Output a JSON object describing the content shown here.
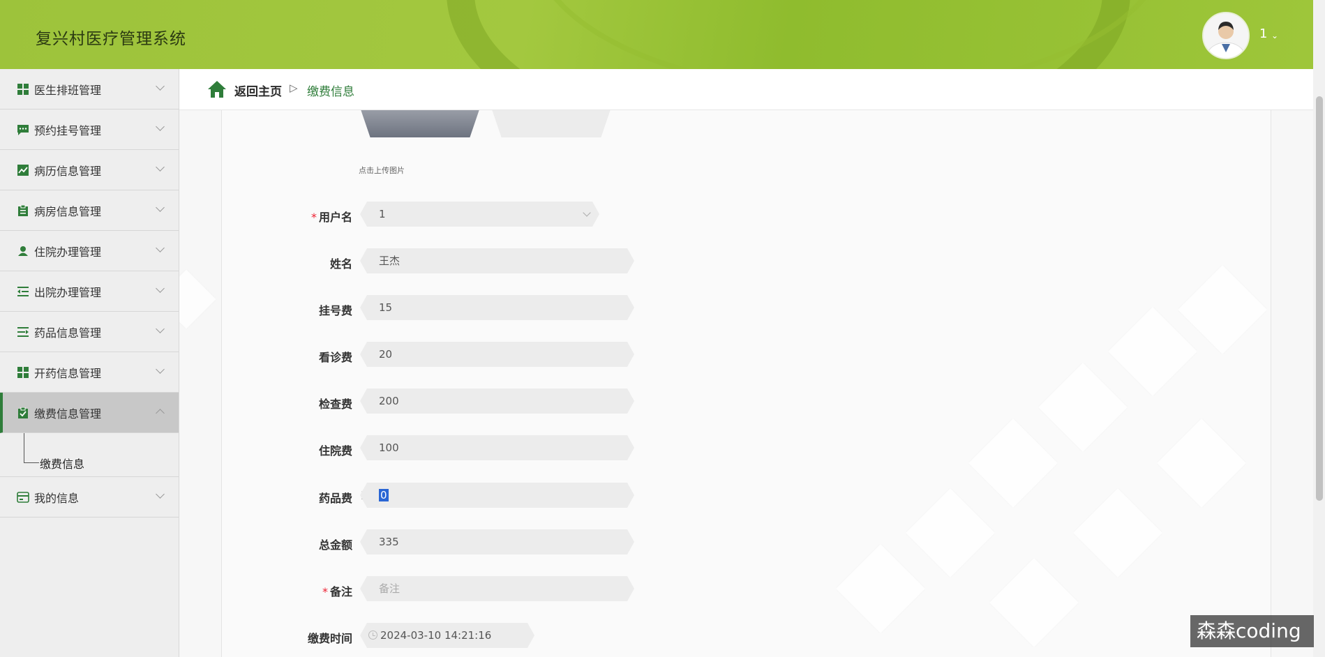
{
  "header": {
    "app_title": "复兴村医疗管理系统",
    "username": "1",
    "brand_color": "#9dc33b"
  },
  "sidebar": {
    "items": [
      {
        "label": "医生排班管理",
        "icon": "grid-icon"
      },
      {
        "label": "预约挂号管理",
        "icon": "chat-icon"
      },
      {
        "label": "病历信息管理",
        "icon": "chart-line-icon"
      },
      {
        "label": "病房信息管理",
        "icon": "clipboard-icon"
      },
      {
        "label": "住院办理管理",
        "icon": "user-icon"
      },
      {
        "label": "出院办理管理",
        "icon": "outdent-icon"
      },
      {
        "label": "药品信息管理",
        "icon": "list-icon"
      },
      {
        "label": "开药信息管理",
        "icon": "grid-icon"
      },
      {
        "label": "缴费信息管理",
        "icon": "clipboard-check-icon",
        "active": true
      },
      {
        "label": "我的信息",
        "icon": "card-icon"
      }
    ],
    "submenu_label": "缴费信息"
  },
  "breadcrumb": {
    "home_label": "返回主页",
    "separator": "▷",
    "current": "缴费信息"
  },
  "form": {
    "upload_hint": "点击上传图片",
    "username": {
      "label": "用户名",
      "value": "1",
      "required": true
    },
    "name": {
      "label": "姓名",
      "value": "王杰"
    },
    "registration_fee": {
      "label": "挂号费",
      "value": "15"
    },
    "consultation_fee": {
      "label": "看诊费",
      "value": "20"
    },
    "exam_fee": {
      "label": "检查费",
      "value": "200"
    },
    "hospital_fee": {
      "label": "住院费",
      "value": "100"
    },
    "medicine_fee": {
      "label": "药品费",
      "value": "0"
    },
    "total": {
      "label": "总金额",
      "value": "335"
    },
    "remark": {
      "label": "备注",
      "placeholder": "备注",
      "required": true
    },
    "payment_time": {
      "label": "缴费时间",
      "value": "2024-03-10 14:21:16"
    }
  },
  "watermark": "森森coding"
}
